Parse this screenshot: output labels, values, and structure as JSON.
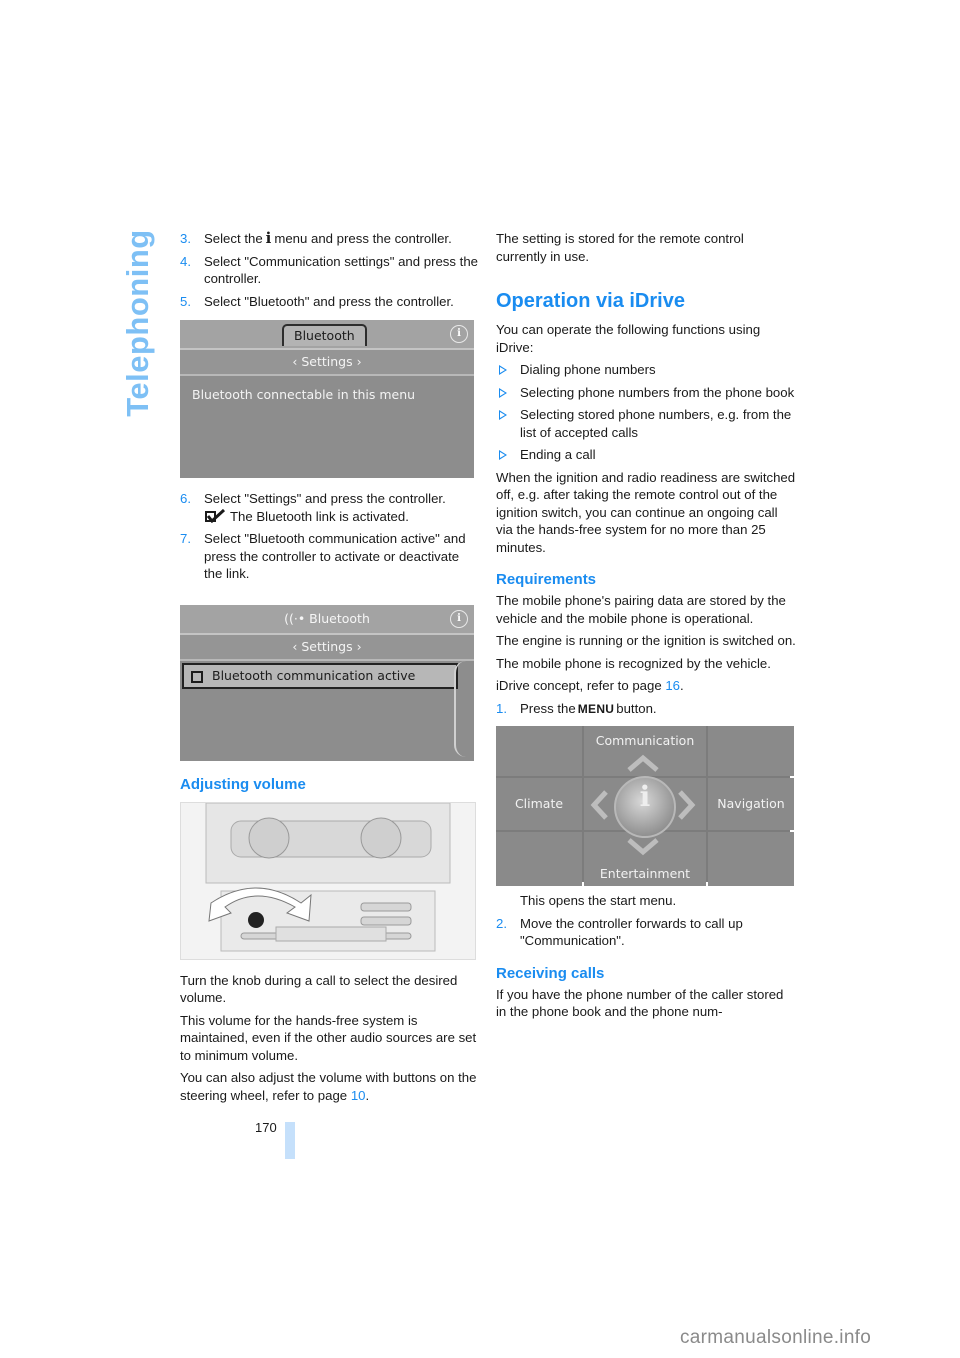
{
  "section_title": "Telephoning",
  "page_number": "170",
  "left": {
    "steps_a": [
      {
        "num": "3.",
        "pre": "Select the",
        "icon": "info-i-icon",
        "post": "menu and press the controller."
      },
      {
        "num": "4.",
        "text": "Select \"Communication settings\" and press the controller."
      },
      {
        "num": "5.",
        "text": "Select \"Bluetooth\" and press the controller."
      }
    ],
    "screen1": {
      "tab": "Bluetooth",
      "info_glyph": "i",
      "subheader": "‹ Settings ›",
      "body": "Bluetooth connectable in this menu"
    },
    "steps_b": [
      {
        "num": "6.",
        "text": "Select \"Settings\" and press the controller.",
        "sub": "The Bluetooth link is activated."
      },
      {
        "num": "7.",
        "text": "Select \"Bluetooth communication active\" and press the controller to activate or deactivate the link."
      }
    ],
    "screen2": {
      "title": "((·• Bluetooth",
      "info_glyph": "i",
      "subheader": "‹ Settings ›",
      "row": "Bluetooth communication active",
      "row_checked": false
    },
    "volume_heading": "Adjusting volume",
    "volume_paras": [
      "Turn the knob during a call to select the desired volume.",
      "This volume for the hands-free system is maintained, even if the other audio sources are set to minimum volume."
    ],
    "volume_ref": {
      "text": "You can also adjust the volume with buttons on the steering wheel, refer to page ",
      "page": "10",
      "end": "."
    }
  },
  "right": {
    "intro": "The setting is stored for the remote control currently in use.",
    "h_operation": "Operation via iDrive",
    "op_intro": "You can operate the following functions using iDrive:",
    "bullets": [
      "Dialing phone numbers",
      "Selecting phone numbers from the phone book",
      "Selecting stored phone numbers, e.g. from the list of accepted calls",
      "Ending a call"
    ],
    "ignition_para": "When the ignition and radio readiness are switched off, e.g. after taking the remote control out of the ignition switch, you can continue an ongoing call via the hands-free system for no more than 25 minutes.",
    "h_requirements": "Requirements",
    "req_paras": [
      "The mobile phone's pairing data are stored by the vehicle and the mobile phone is operational.",
      "The engine is running or the ignition is switched on.",
      "The mobile phone is recognized by the vehicle."
    ],
    "idrive_ref": {
      "text": "iDrive concept, refer to page ",
      "page": "16",
      "end": "."
    },
    "step1": {
      "num": "1.",
      "pre": "Press the",
      "button": "MENU",
      "post": "button."
    },
    "start_menu": {
      "top": "Communication",
      "left": "Climate",
      "right": "Navigation",
      "bottom": "Entertainment",
      "center_glyph": "i"
    },
    "step1_note": "This opens the start menu.",
    "step2": {
      "num": "2.",
      "text": "Move the controller forwards to call up \"Communication\"."
    },
    "h_receiving": "Receiving calls",
    "receiving_para": "If you have the phone number of the caller stored in the phone book and the phone num-"
  },
  "watermark": "carmanualsonline.info",
  "colors": {
    "accent": "#1a8cf0",
    "side_title": "#7ec0f5",
    "page_bar": "#c5e0fb"
  }
}
